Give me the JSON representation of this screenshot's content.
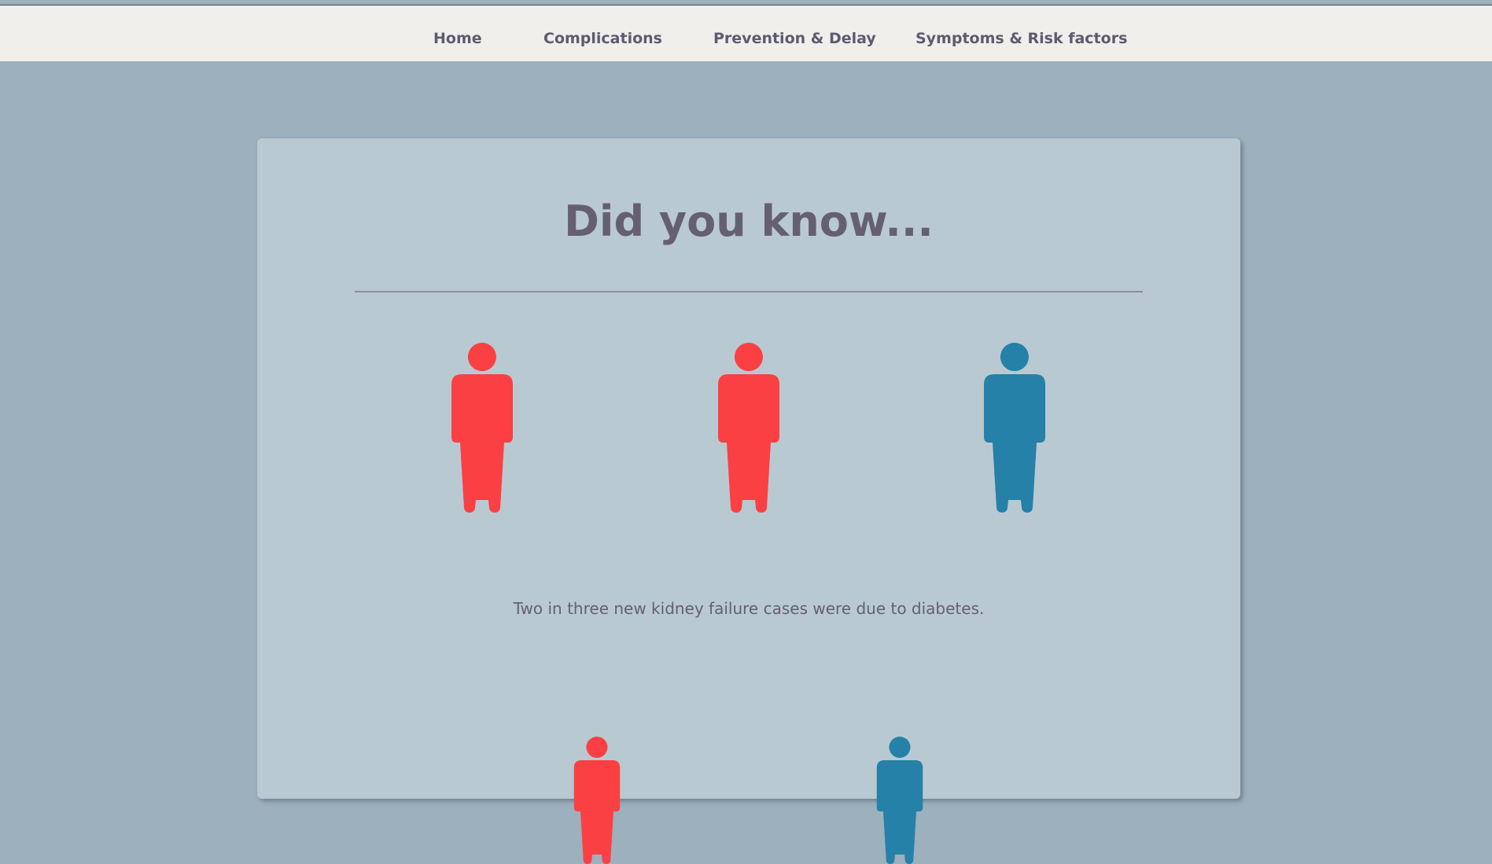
{
  "nav": {
    "items": [
      {
        "label": "Home"
      },
      {
        "label": "Complications"
      },
      {
        "label": "Prevention & Delay"
      },
      {
        "label": "Symptoms & Risk factors"
      }
    ]
  },
  "card": {
    "title": "Did you know...",
    "facts": [
      {
        "text": "Two in three new kidney failure cases were due to diabetes.",
        "figures": [
          {
            "icon": "person-icon",
            "color": "#fb4044"
          },
          {
            "icon": "person-icon",
            "color": "#fb4044"
          },
          {
            "icon": "person-icon",
            "color": "#2581a8"
          }
        ]
      },
      {
        "figures": [
          {
            "icon": "person-icon",
            "color": "#fb4044"
          },
          {
            "icon": "person-icon",
            "color": "#2581a8"
          }
        ]
      }
    ]
  },
  "colors": {
    "page_background": "#9cb0bd",
    "card_background": "#b9c9d1",
    "nav_background": "#f0efec",
    "text": "#65606f"
  }
}
